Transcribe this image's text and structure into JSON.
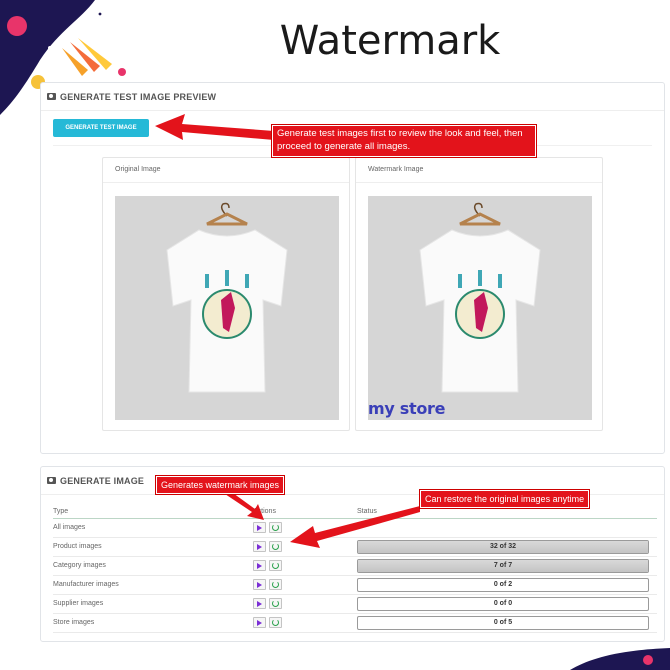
{
  "page_title": "Watermark",
  "preview_panel": {
    "heading": "GENERATE TEST IMAGE PREVIEW",
    "button_label": "GENERATE TEST IMAGE",
    "original_caption": "Original Image",
    "watermark_caption": "Watermark Image",
    "watermark_text": "my store"
  },
  "generate_panel": {
    "heading": "GENERATE IMAGE",
    "columns": [
      "Type",
      "Actions",
      "Status"
    ],
    "rows": [
      {
        "type": "All images",
        "status": "",
        "progress": null
      },
      {
        "type": "Product images",
        "status": "32 of 32",
        "progress": 1.0
      },
      {
        "type": "Category images",
        "status": "7 of 7",
        "progress": 1.0
      },
      {
        "type": "Manufacturer images",
        "status": "0 of 2",
        "progress": 0
      },
      {
        "type": "Supplier images",
        "status": "0 of 0",
        "progress": 0
      },
      {
        "type": "Store images",
        "status": "0 of 5",
        "progress": 0
      }
    ]
  },
  "annotations": {
    "test_image_note": "Generate test images first to review the look and feel, then proceed to generate all images.",
    "generate_note": "Generates watermark images",
    "restore_note": "Can restore the original images anytime"
  },
  "colors": {
    "primary_button": "#25b9d7",
    "annotation": "#e3131b",
    "play_icon": "#7b2ed6",
    "restore_icon": "#2aa14c"
  }
}
